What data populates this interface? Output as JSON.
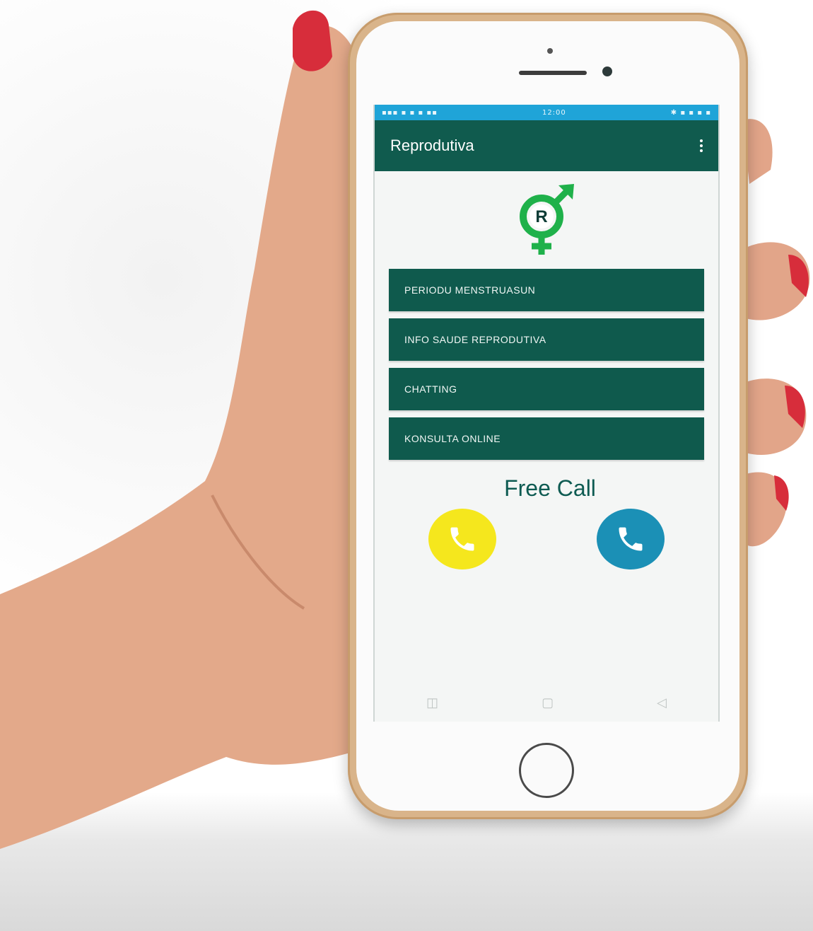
{
  "status_bar": {
    "left": "▪▪▪ ▪ ▪ ▪ ▪▪",
    "center": "12:00",
    "right": "✱ ▪ ▪ ▪ ▪"
  },
  "app_bar": {
    "title": "Reprodutiva",
    "overflow_icon": "more-vertical-icon"
  },
  "logo": {
    "letter": "R",
    "icon": "gender-symbol-icon",
    "color": "#1fb14a"
  },
  "menu": {
    "items": [
      {
        "label": "PERIODU MENSTRUASUN"
      },
      {
        "label": "INFO SAUDE REPRODUTIVA"
      },
      {
        "label": "CHATTING"
      },
      {
        "label": "KONSULTA ONLINE"
      }
    ]
  },
  "free_call": {
    "title": "Free Call",
    "buttons": [
      {
        "icon": "phone-icon",
        "color": "#f5e71d"
      },
      {
        "icon": "phone-icon",
        "color": "#1b90b6"
      }
    ]
  },
  "nav": {
    "recent": "◫",
    "home": "▢",
    "back": "◁"
  },
  "colors": {
    "primary": "#105b4e",
    "status": "#1fa4d8",
    "background": "#f4f6f5"
  }
}
